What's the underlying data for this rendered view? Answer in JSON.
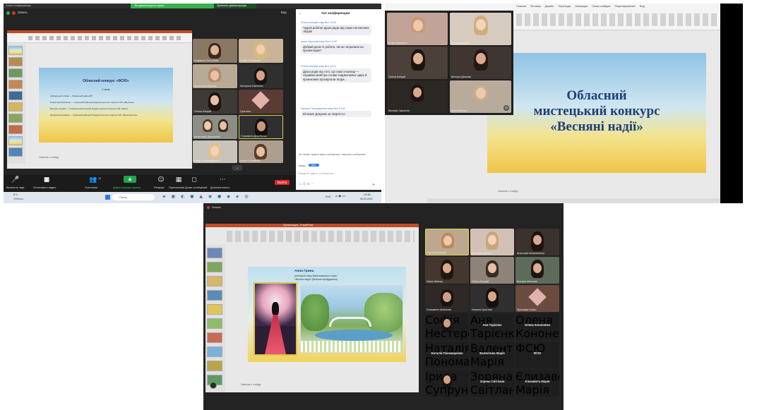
{
  "screen1": {
    "window_title": "Zoom Конференція",
    "top_label": "Запись",
    "share_banner": "Ви демонструєте екран",
    "share_stop": "Зупинити демонстрацію",
    "view_label": "Вид",
    "slide_title": "Обласний конкурс «ФСЮ»",
    "slide_lines": [
      "1 сесія",
      "Кобзарський співак — Рахівський район ВТ",
      "Рожеві мрії Буковини — Сумський районний будинок дитячої творчості ВТ «Веселка»",
      "Весняні струмки — Сокирянський міський будинок дитячої творчості ВТ «Мрія»",
      "Буковинська фарба — Сумський районний будинок дитячої творчості ВТ «Веселиночка»"
    ],
    "notes_placeholder": "Заметки к слайду",
    "participants": [
      "Людмила Пастухова",
      "Софія Пілишенко",
      "Валентина Карпюк",
      "Катерина Савченко",
      "Олена Клецай",
      "Гусятино",
      "Валентина Денисенко",
      "Єлизавета Дерибаска",
      "Надія Тонкошкуренко",
      "Ірина Соловйова"
    ],
    "chat_title": "Чат конференции",
    "messages": [
      {
        "who": "Олена Клецай кому Все 14:00",
        "text": "Чудові роботи! Душа радіє від таких натхненних творів!"
      },
      {
        "who": "Ірина Нікулова кому Все 14:00",
        "text": "Добрий день! Є роботи, які не потрапили на презентацію?"
      },
      {
        "who": "Олена Клецай кому Все 14:01",
        "text": "Душа радіє від того, що наші учасниці — справжні майстри слова! Надзвичайно щиро й проникливо прозвучали твори..."
      },
      {
        "who": "Наталія Пономаренко кому Все 14:01",
        "text": "Вітаємо! Дякуємо за творчість!"
      }
    ],
    "chat_footer_note": "Кто может видеть ваши сообщения? Записать сообщения",
    "to_label": "Кому:",
    "to_value": "Все",
    "input_placeholder": "Введите здесь сообщение...",
    "toolbar": [
      {
        "icon": "microphone-icon",
        "glyph": "🎤",
        "label": "Включить звук"
      },
      {
        "icon": "camera-icon",
        "glyph": "■",
        "label": "Остановить видео"
      },
      {
        "icon": "participants-icon",
        "glyph": "👥",
        "label": "Участники",
        "badge": "12"
      },
      {
        "icon": "share-screen-icon",
        "glyph": "▲",
        "label": "Демонстрация экрана"
      },
      {
        "icon": "reactions-icon",
        "glyph": "☺",
        "label": "Реакции"
      },
      {
        "icon": "apps-icon",
        "glyph": "▦",
        "label": "Приложения"
      },
      {
        "icon": "whiteboard-icon",
        "glyph": "◻",
        "label": "Доски сообщений"
      },
      {
        "icon": "more-icon",
        "glyph": "···",
        "label": "Дополнительно"
      }
    ],
    "leave_label": "Выйти",
    "taskbar": {
      "weather": "8°C",
      "weather_desc": "Облачно",
      "search": "Поиск",
      "lang": "ENG",
      "time": "13:48",
      "date": "06.03.2024"
    }
  },
  "screen2": {
    "menu": [
      "Файл",
      "Главная",
      "Вставка",
      "Дизайн",
      "Переходы",
      "Анимация",
      "Показ слайдов",
      "Рецензирование",
      "Вид"
    ],
    "slide_line1": "Обласний",
    "slide_line2": "мистецький конкурс",
    "slide_line3": "«Весняні надії»",
    "notes_placeholder": "Заметки к слайду",
    "participants": [
      "Юлія Сімоненко",
      "Катерина Бугай",
      "Олена Клецай",
      "Вікторія Данилко",
      "Валерія Скрипник",
      "Ірина Шевчук"
    ]
  },
  "screen3": {
    "title": "Запись",
    "window_title": "Презентация - PowerPoint",
    "caption_name": "Анна Гринь",
    "caption_line2": "учениця 8 класу Васильківського ліцею",
    "caption_line3": "«Весняні надії» (Весняне пробудження)",
    "notes_placeholder": "Заметки к слайду",
    "participants": [
      "Кузина Білецька",
      "Ірина Денисенко",
      "Анастасія Калиниченко",
      "Марія Шевчук",
      "Олена Клецай",
      "Вікторія Мельник",
      "Єлизавета Шевченко",
      "Наталія Гусятина",
      "Ярослава Бойко"
    ],
    "name_tiles": [
      {
        "big": "",
        "small": "Софія Нестеренко"
      },
      {
        "big": "Аня Тарієнко",
        "small": "Аня Тарієнко"
      },
      {
        "big": "Олена Кононенко",
        "small": "Олена Кононенко"
      },
      {
        "big": "Наталія Пономаренко",
        "small": "Наталія Пономаренко"
      },
      {
        "big": "Валентина Марія",
        "small": "Валентина Марія"
      },
      {
        "big": "ФСЮ",
        "small": "ФСЮ"
      },
      {
        "big": "",
        "small": "Ірина Супрунова"
      },
      {
        "big": "Зоряна Світлана",
        "small": "Зоряна Світлана"
      },
      {
        "big": "Єлизавета Марія",
        "small": "Єлизавета Марія"
      }
    ]
  }
}
